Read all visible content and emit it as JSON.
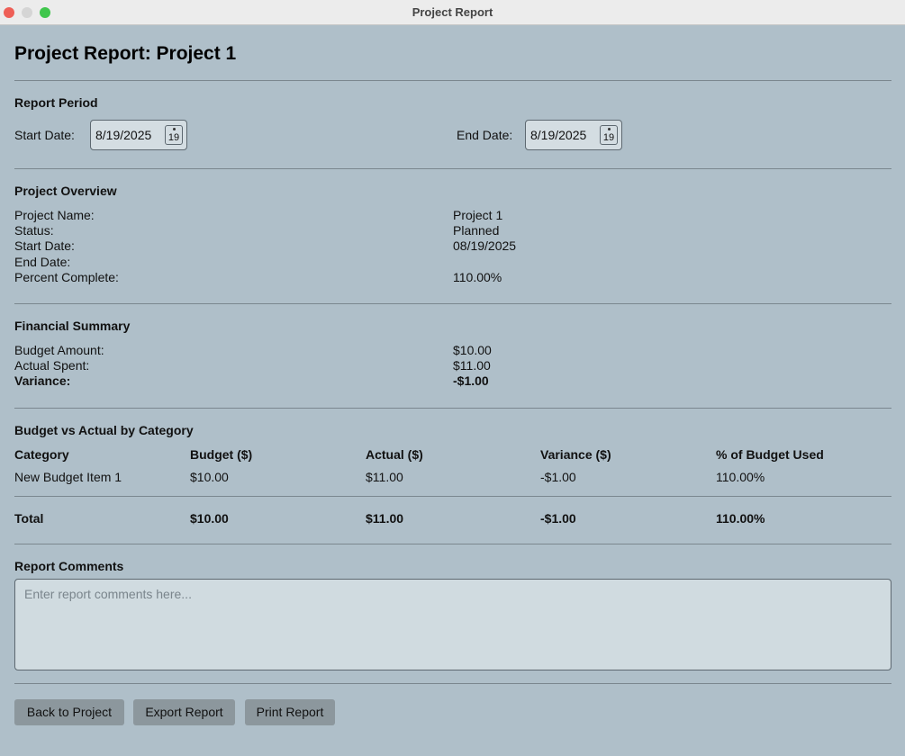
{
  "window": {
    "title": "Project Report"
  },
  "header": {
    "title": "Project Report: Project 1"
  },
  "period": {
    "title": "Report Period",
    "start_label": "Start Date:",
    "start_value": "8/19/2025",
    "end_label": "End Date:",
    "end_value": "8/19/2025",
    "calendar_day": "19"
  },
  "overview": {
    "title": "Project Overview",
    "rows": [
      {
        "label": "Project Name:",
        "value": "Project 1"
      },
      {
        "label": "Status:",
        "value": "Planned"
      },
      {
        "label": "Start Date:",
        "value": "08/19/2025"
      },
      {
        "label": "End Date:",
        "value": ""
      },
      {
        "label": "Percent Complete:",
        "value": "110.00%"
      }
    ]
  },
  "financial": {
    "title": "Financial Summary",
    "rows": [
      {
        "label": "Budget Amount:",
        "value": "$10.00"
      },
      {
        "label": "Actual Spent:",
        "value": "$11.00"
      },
      {
        "label": "Variance:",
        "value": "-$1.00"
      }
    ]
  },
  "budget_table": {
    "title": "Budget vs Actual by Category",
    "headers": [
      "Category",
      "Budget ($)",
      "Actual ($)",
      "Variance ($)",
      "% of Budget Used"
    ],
    "rows": [
      [
        "New Budget Item 1",
        "$10.00",
        "$11.00",
        "-$1.00",
        "110.00%"
      ]
    ],
    "total": [
      "Total",
      "$10.00",
      "$11.00",
      "-$1.00",
      "110.00%"
    ]
  },
  "comments": {
    "title": "Report Comments",
    "placeholder": "Enter report comments here..."
  },
  "buttons": {
    "back": "Back to Project",
    "export": "Export Report",
    "print": "Print Report"
  }
}
